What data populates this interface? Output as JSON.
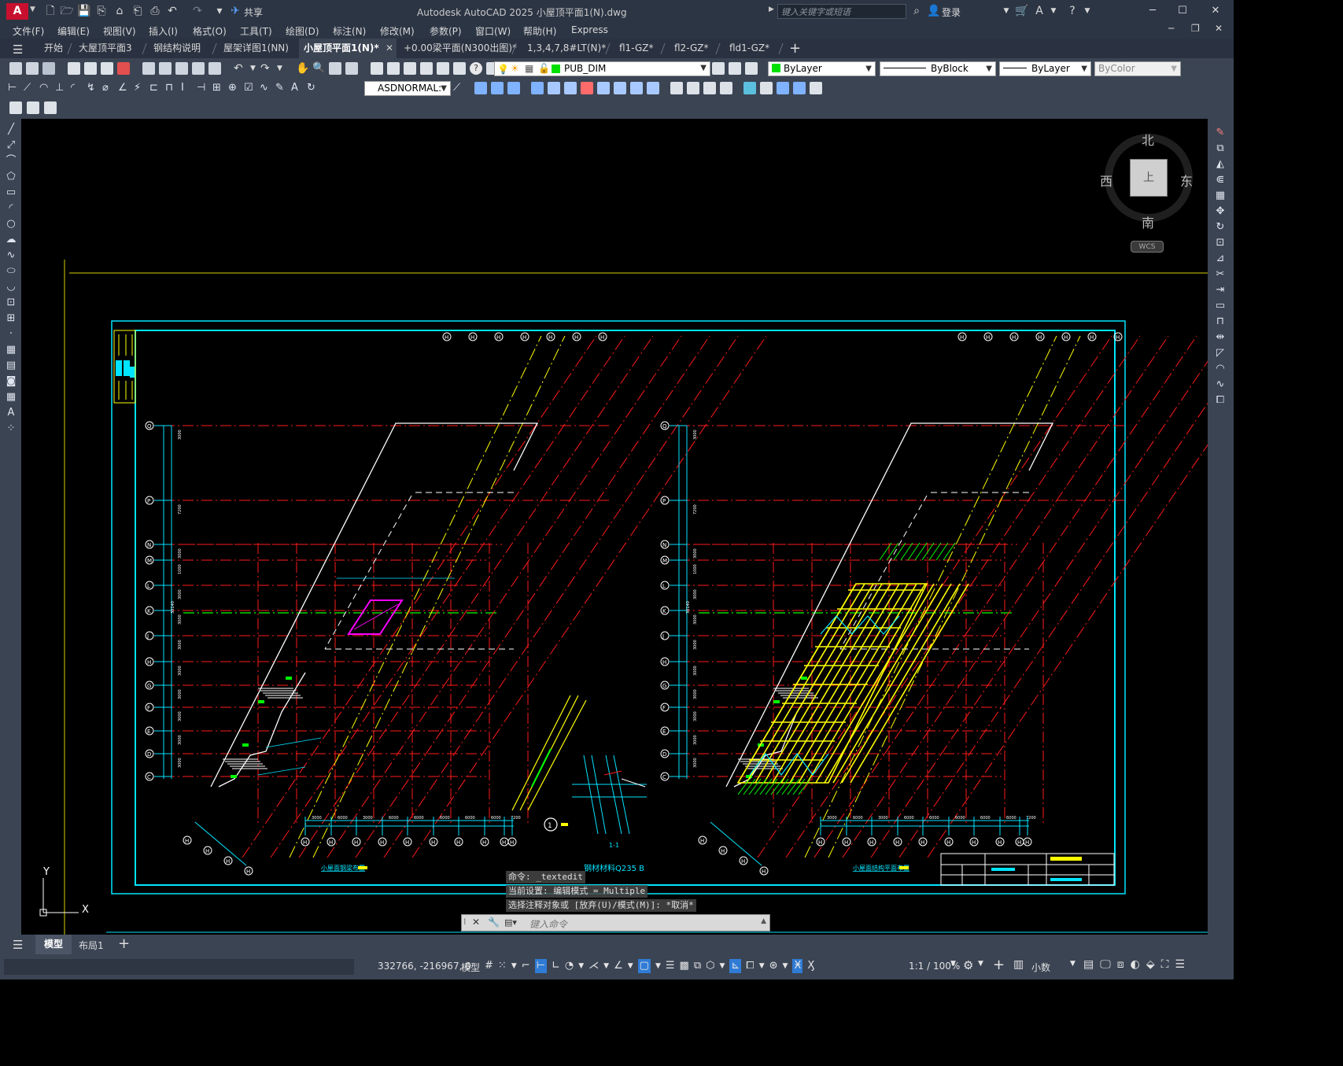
{
  "app": {
    "title": "Autodesk AutoCAD 2025    小屋顶平面1(N).dwg",
    "logo": "A",
    "share_label": "共享",
    "search_placeholder": "键入关键字或短语",
    "login_label": "登录"
  },
  "menu": [
    "文件(F)",
    "编辑(E)",
    "视图(V)",
    "插入(I)",
    "格式(O)",
    "工具(T)",
    "绘图(D)",
    "标注(N)",
    "修改(M)",
    "参数(P)",
    "窗口(W)",
    "帮助(H)",
    "Express"
  ],
  "tabs": [
    {
      "label": "开始",
      "active": false
    },
    {
      "label": "大屋顶平面3",
      "active": false
    },
    {
      "label": "钢结构说明",
      "active": false
    },
    {
      "label": "屋架详图1(NN)",
      "active": false
    },
    {
      "label": "小屋顶平面1(N)*",
      "active": true
    },
    {
      "label": "+0.00梁平面(N300出图)*",
      "active": false
    },
    {
      "label": "1,3,4,7,8#LT(N)*",
      "active": false
    },
    {
      "label": "fl1-GZ*",
      "active": false
    },
    {
      "label": "fl2-GZ*",
      "active": false
    },
    {
      "label": "fld1-GZ*",
      "active": false
    }
  ],
  "toolbar": {
    "layer": "PUB_DIM",
    "color": "ByLayer",
    "linetype": "ByBlock",
    "lineweight": "ByLayer",
    "plotstyle": "ByColor",
    "dimstyle": "ASDNORMAL:"
  },
  "viewcube": {
    "north": "北",
    "south": "南",
    "east": "东",
    "west": "西",
    "top": "上",
    "wcs": "WCS"
  },
  "drawing": {
    "axis_rows": [
      "Q",
      "P",
      "N",
      "M",
      "L",
      "K",
      "J",
      "H",
      "G",
      "F",
      "E",
      "D",
      "C"
    ],
    "axis_cols": [
      "H",
      "H",
      "H",
      "H",
      "H",
      "H",
      "H",
      "H",
      "H",
      "H"
    ],
    "left_caption": "小屋面钢梁布置",
    "right_caption": "小屋面结构平面布置",
    "material_note": "钢材材料Q235 B",
    "section_label": "1-1",
    "section_no": "1",
    "dims_bottom_left": [
      "3000",
      "6000",
      "3000",
      "6000",
      "6000",
      "6000",
      "6000",
      "6000",
      "7200"
    ],
    "dims_bottom_right": [
      "3000",
      "6000",
      "3000",
      "6000",
      "6000",
      "6000",
      "6000",
      "6000",
      "7200"
    ],
    "dims_left_vertical": [
      "3000",
      "7200",
      "3000",
      "1000",
      "3000",
      "3000",
      "3000",
      "3000",
      "3000",
      "3000",
      "3000",
      "3000"
    ],
    "total_dim": "30140",
    "ucs_x": "X",
    "ucs_y": "Y"
  },
  "command": {
    "lines": [
      "命令: _textedit",
      "当前设置: 编辑模式 = Multiple",
      "选择注释对象或 [放弃(U)/模式(M)]: *取消*"
    ],
    "placeholder": "键入命令"
  },
  "layout_tabs": [
    {
      "label": "模型",
      "active": true
    },
    {
      "label": "布局1",
      "active": false
    }
  ],
  "status": {
    "coords": "332766, -216967, 0",
    "mode": "模型",
    "scale": "1:1 / 100%",
    "units": "小数"
  },
  "colors": {
    "accent": "#00e5ff",
    "red": "#ff1a1a",
    "yellow": "#ffff00",
    "green": "#00ff00",
    "magenta": "#ff00ff",
    "white": "#ffffff"
  }
}
